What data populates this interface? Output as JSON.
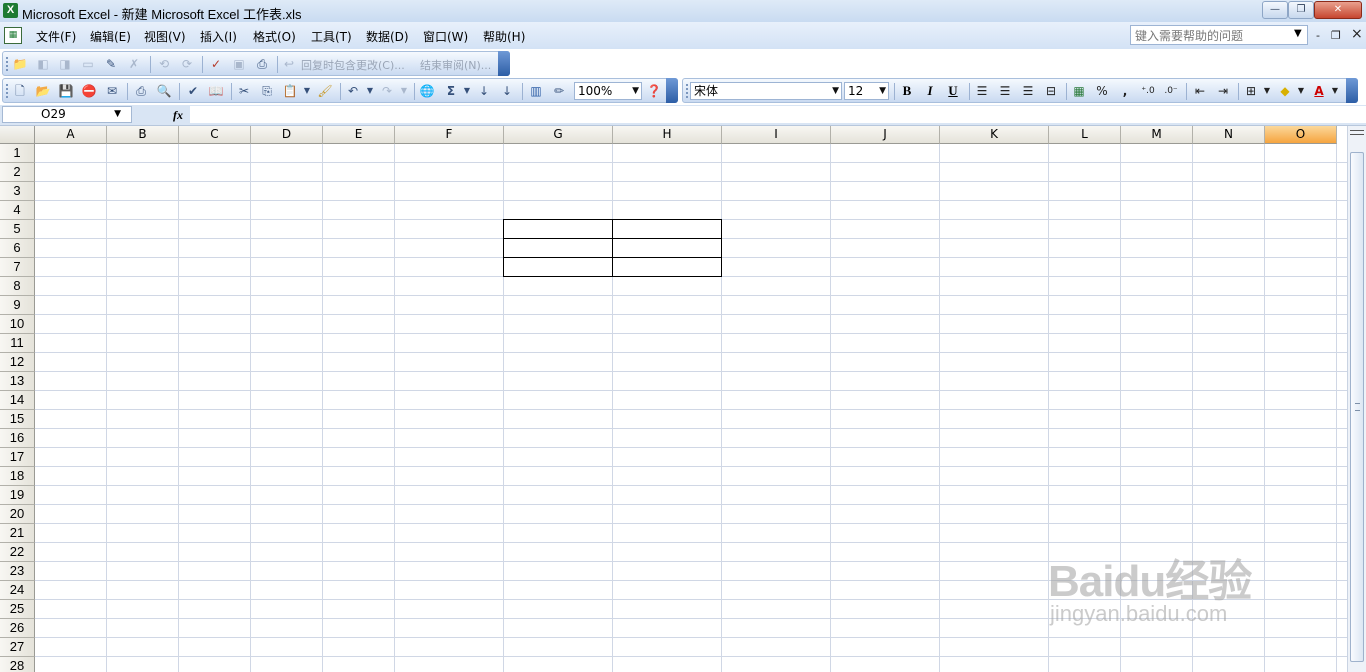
{
  "window": {
    "title": "Microsoft Excel - 新建 Microsoft Excel 工作表.xls",
    "app_icon_letter": "X",
    "buttons": {
      "minimize": "—",
      "restore": "❐",
      "close": "✕"
    }
  },
  "menubar": {
    "items": [
      "文件(F)",
      "编辑(E)",
      "视图(V)",
      "插入(I)",
      "格式(O)",
      "工具(T)",
      "数据(D)",
      "窗口(W)",
      "帮助(H)"
    ],
    "help_placeholder": "键入需要帮助的问题",
    "mdi": {
      "minimize": "-",
      "restore": "❐",
      "close": "×"
    }
  },
  "review_toolbar": {
    "reply_label": "回复时包含更改(C)...",
    "end_review_label": "结束审阅(N)..."
  },
  "standard_toolbar": {
    "zoom": "100%"
  },
  "format_toolbar": {
    "font": "宋体",
    "size": "12",
    "bold": "B",
    "italic": "I",
    "underline": "U",
    "percent": "%",
    "comma": ","
  },
  "formula_bar": {
    "name_box": "O29",
    "fx": "fx",
    "formula": ""
  },
  "sheet": {
    "columns": [
      "A",
      "B",
      "C",
      "D",
      "E",
      "F",
      "G",
      "H",
      "I",
      "J",
      "K",
      "L",
      "M",
      "N",
      "O"
    ],
    "active_column": "O",
    "rows": [
      "1",
      "2",
      "3",
      "4",
      "5",
      "6",
      "7",
      "8",
      "9",
      "10",
      "11",
      "12",
      "13",
      "14",
      "15",
      "16",
      "17",
      "18",
      "19",
      "20",
      "21",
      "22",
      "23",
      "24",
      "25",
      "26",
      "27",
      "28"
    ],
    "bordered_range": "G5:H7"
  },
  "watermark": {
    "brand": "Baidu经验",
    "url": "jingyan.baidu.com"
  }
}
